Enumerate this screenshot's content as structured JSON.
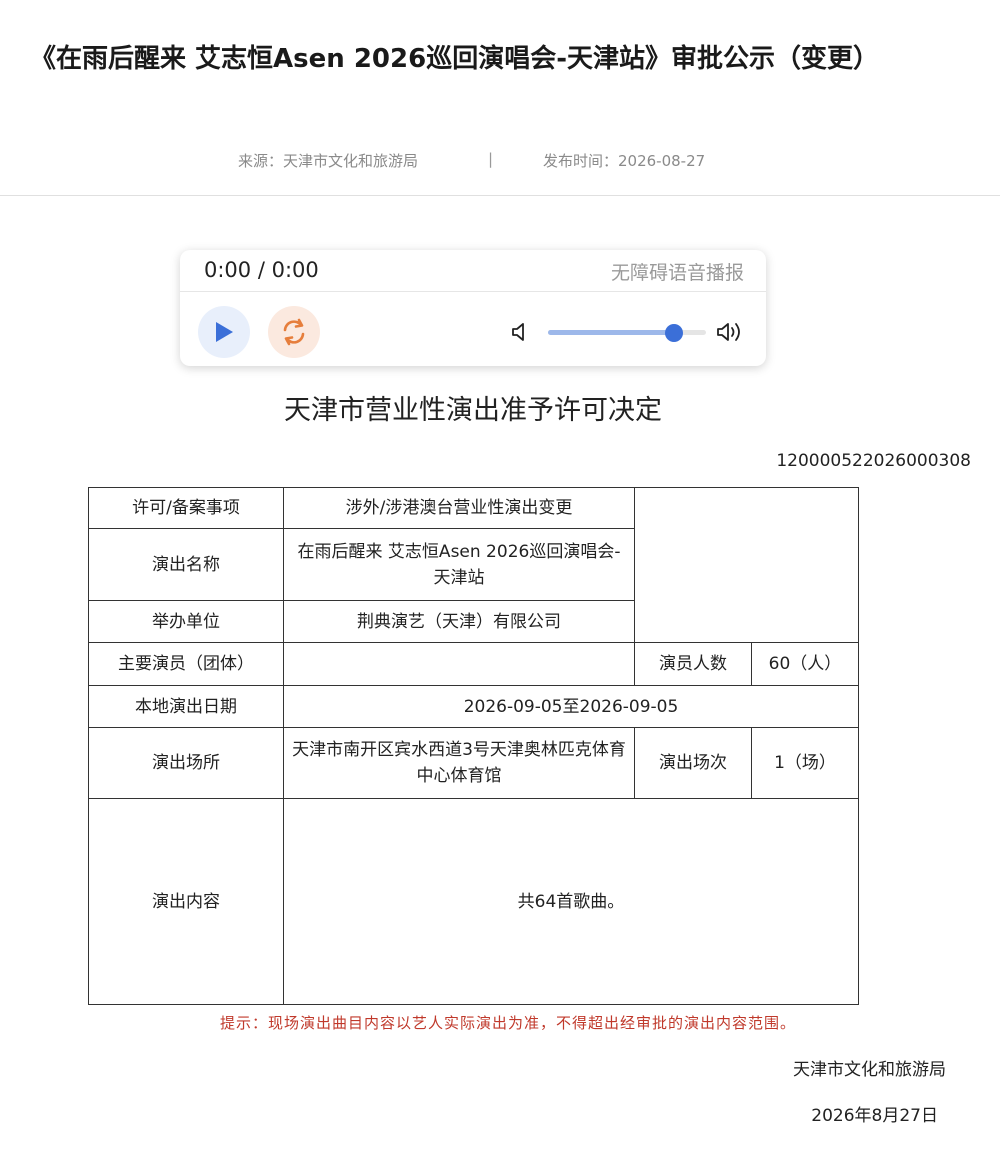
{
  "article": {
    "title": "《在雨后醒来 艾志恒Asen 2026巡回演唱会-天津站》审批公示（变更）",
    "source": "来源：天津市文化和旅游局",
    "separator": "|",
    "publish_time": "发布时间：2026-08-27"
  },
  "player": {
    "time": "0:00 / 0:00",
    "accessibility_label": "无障碍语音播报",
    "volume_percent": 80,
    "icons": [
      "play-icon",
      "loop-icon",
      "volume-low-icon",
      "volume-high-icon"
    ],
    "colors": {
      "play": "#3b6fd8",
      "loop": "#e67e3c",
      "knob": "#3b6fd8"
    }
  },
  "document": {
    "heading": "天津市营业性演出准予许可决定",
    "number": "120000522026000308",
    "table": {
      "item_label": "许可/备案事项",
      "item_value": "涉外/涉港澳台营业性演出变更",
      "name_label": "演出名称",
      "name_value": "在雨后醒来 艾志恒Asen 2026巡回演唱会-天津站",
      "organizer_label": "举办单位",
      "organizer_value": "荆典演艺（天津）有限公司",
      "performers_label": "主要演员（团体）",
      "performers_value": "",
      "performer_count_label": "演员人数",
      "performer_count_value": "60（人）",
      "date_label": "本地演出日期",
      "date_value": "2026-09-05至2026-09-05",
      "venue_label": "演出场所",
      "venue_value": "天津市南开区宾水西道3号天津奥林匹克体育中心体育馆",
      "sessions_label": "演出场次",
      "sessions_value": "1（场）",
      "content_label": "演出内容",
      "content_value": "共64首歌曲。"
    },
    "notice": "提示：现场演出曲目内容以艺人实际演出为准，不得超出经审批的演出内容范围。",
    "issuer": "天津市文化和旅游局",
    "issue_date": "2026年8月27日"
  }
}
